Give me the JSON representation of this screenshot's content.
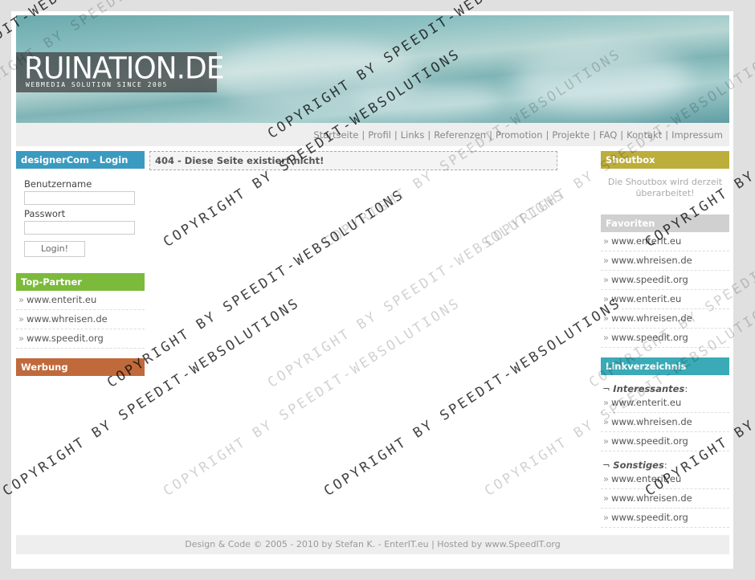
{
  "header": {
    "logo_title": "RUINATION.DE",
    "logo_subtitle": "WEBMEDIA SOLUTION SINCE 2005"
  },
  "nav": {
    "items": [
      "Startseite",
      "Profil",
      "Links",
      "Referenzen",
      "Promotion",
      "Projekte",
      "FAQ",
      "Kontakt",
      "Impressum"
    ]
  },
  "login": {
    "title": "designerCom - Login",
    "username_label": "Benutzername",
    "password_label": "Passwort",
    "button_label": "Login!"
  },
  "top_partner": {
    "title": "Top-Partner",
    "items": [
      "www.enterit.eu",
      "www.whreisen.de",
      "www.speedit.org"
    ]
  },
  "werbung": {
    "title": "Werbung"
  },
  "main": {
    "message": "404 - Diese Seite existiert nicht!"
  },
  "shoutbox": {
    "title": "Shoutbox",
    "text": "Die Shoutbox wird derzeit überarbeitet!"
  },
  "favoriten": {
    "title": "Favoriten",
    "items": [
      "www.enterit.eu",
      "www.whreisen.de",
      "www.speedit.org",
      "www.enterit.eu",
      "www.whreisen.de",
      "www.speedit.org"
    ]
  },
  "linkverzeichnis": {
    "title": "Linkverzeichnis",
    "sections": [
      {
        "heading": "Interessantes",
        "items": [
          "www.enterit.eu",
          "www.whreisen.de",
          "www.speedit.org"
        ]
      },
      {
        "heading": "Sonstiges",
        "items": [
          "www.enterit.eu",
          "www.whreisen.de",
          "www.speedit.org"
        ]
      }
    ]
  },
  "footer": {
    "text": "Design & Code © 2005 - 2010 by Stefan K. - EnterIT.eu | Hosted by www.SpeedIT.org"
  },
  "watermark": {
    "text": "COPYRIGHT BY SPEEDIT-WEBSOLUTIONS"
  },
  "colors": {
    "login_title": "#3b9ac0",
    "top_partner_title": "#7cba3c",
    "werbung_title": "#c0693a",
    "shoutbox_title": "#bdae3c",
    "favoriten_title": "#d0d0d0",
    "linkverzeichnis_title": "#3aaab6"
  }
}
